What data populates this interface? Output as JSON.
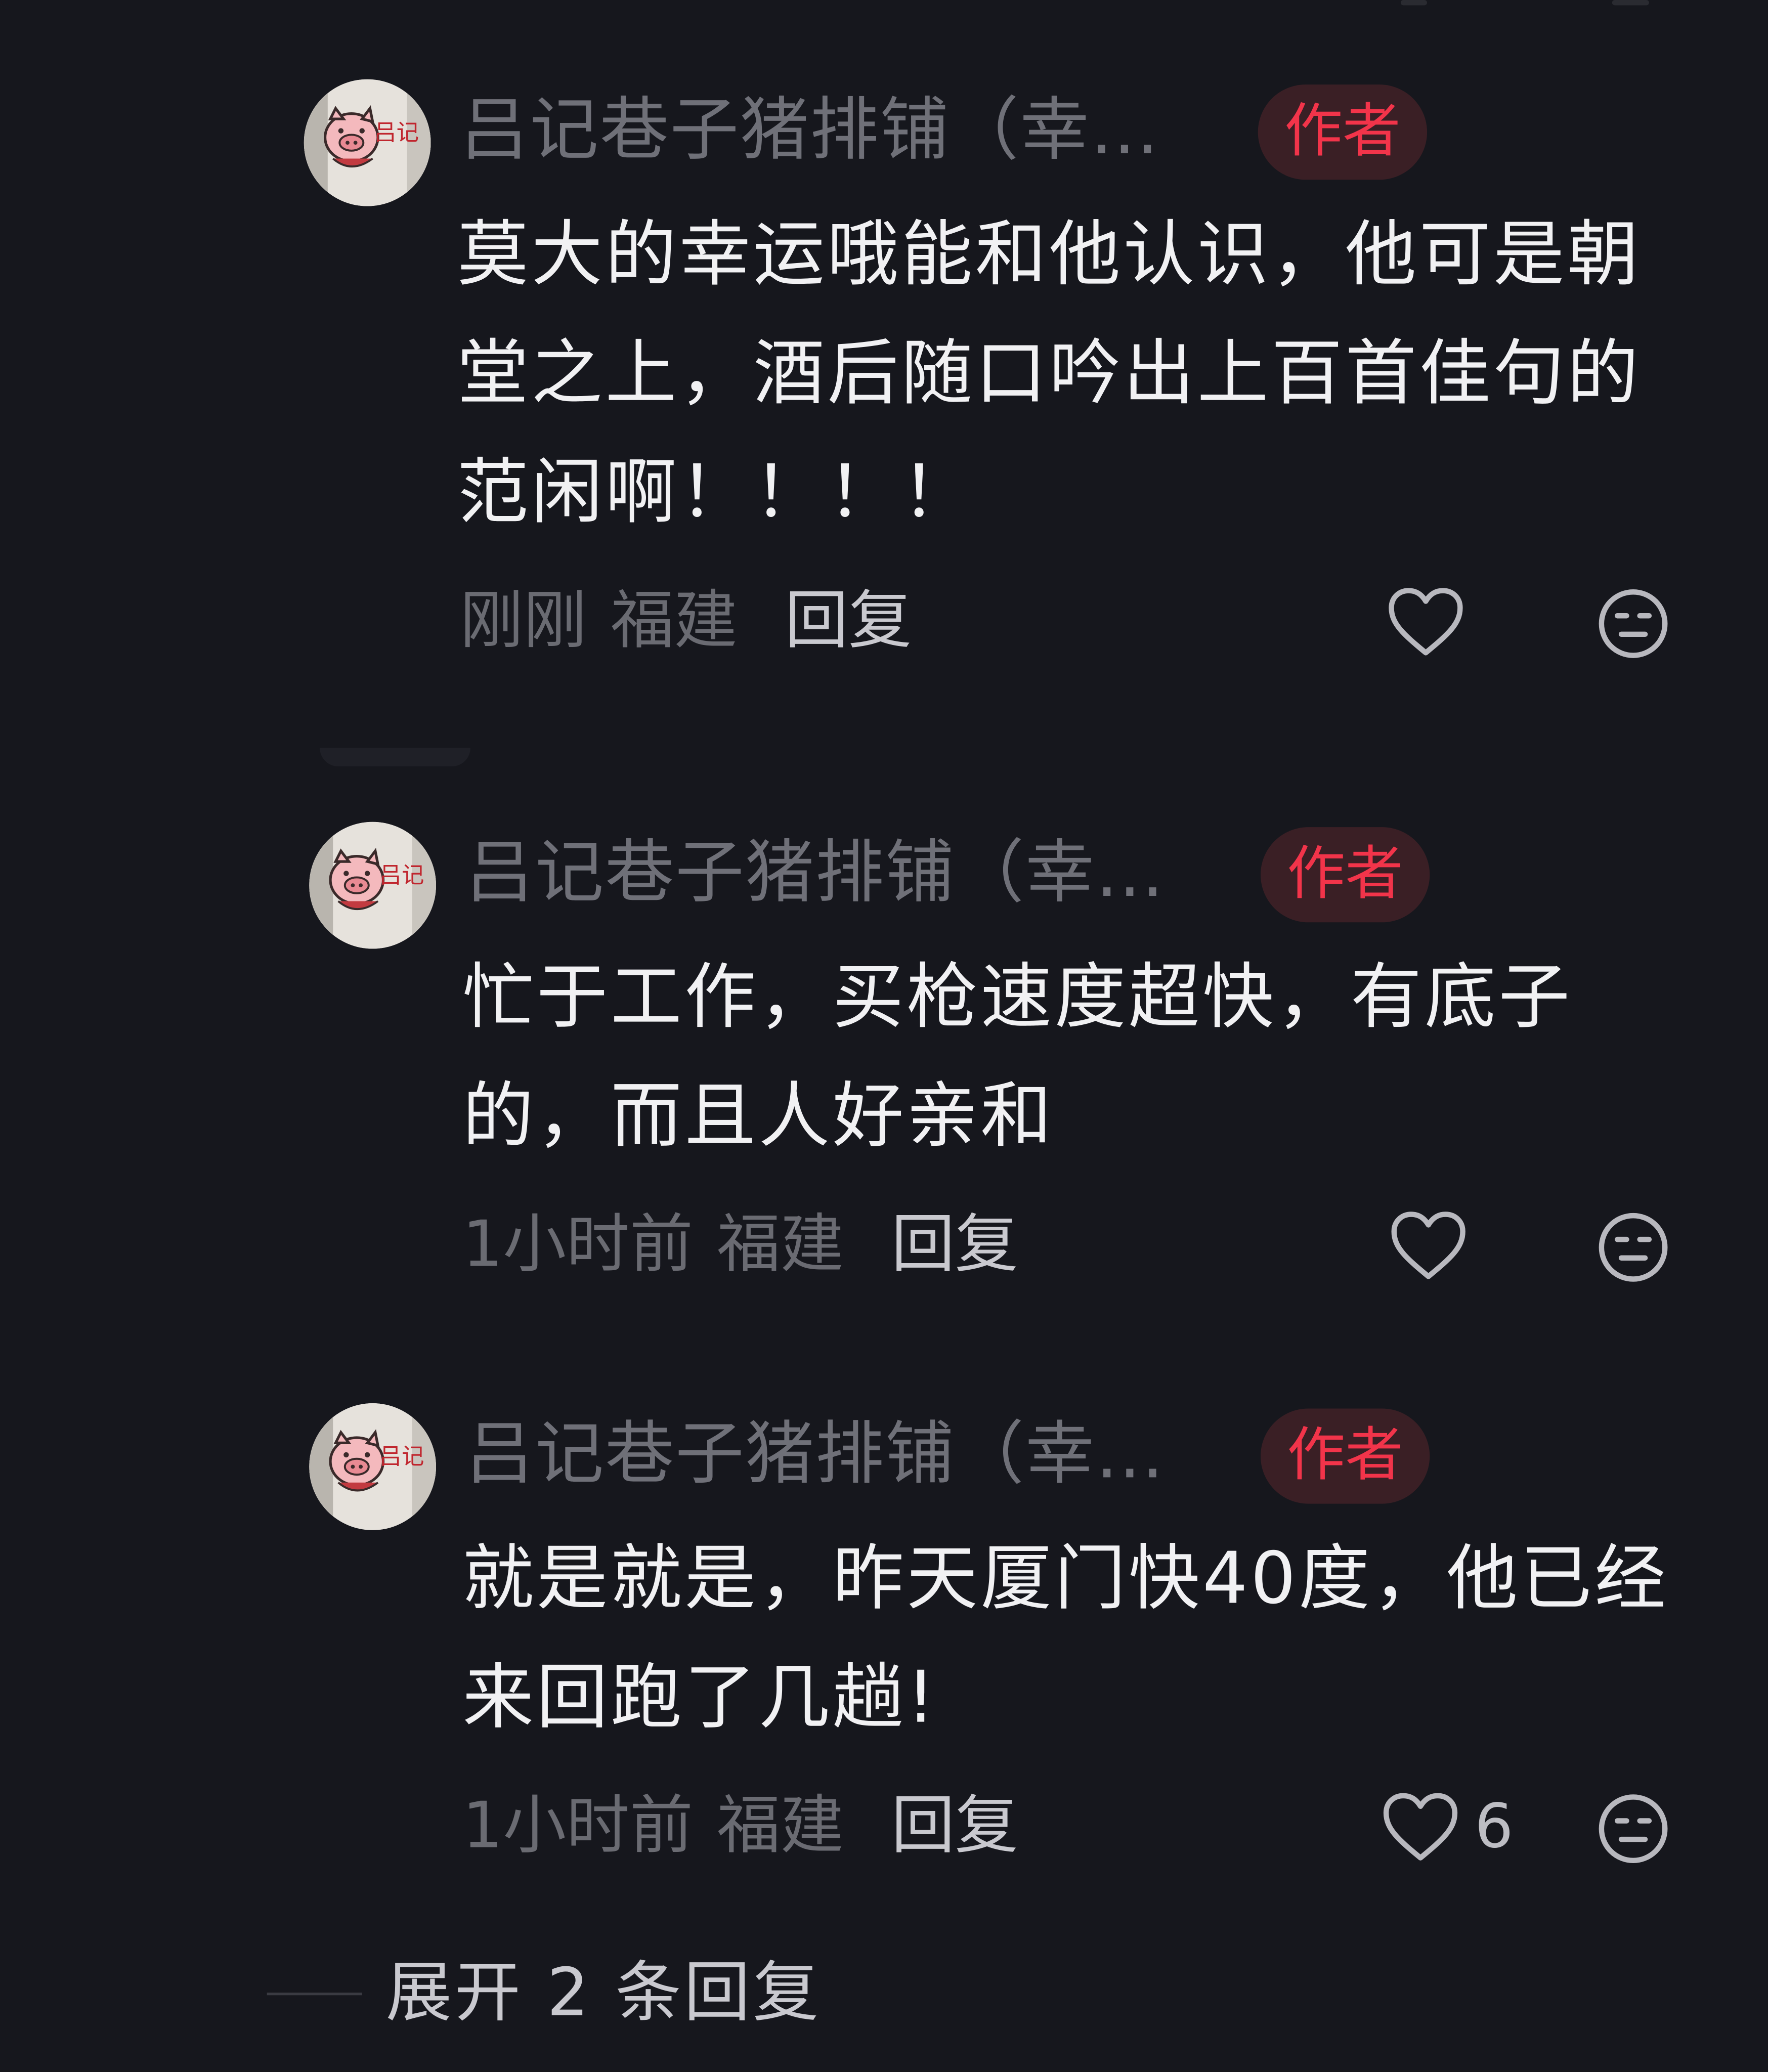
{
  "comments": [
    {
      "username": "吕记巷子猪排铺（幸…",
      "badge": "作者",
      "content": "莫大的幸运哦能和他认识，他可是朝堂之上，酒后随口吟出上百首佳句的范闲啊！！！！",
      "time": "刚刚",
      "location": "福建",
      "reply": "回复",
      "likes": ""
    },
    {
      "username": "吕记巷子猪排铺（幸…",
      "badge": "作者",
      "content": "忙于工作，买枪速度超快，有底子的，而且人好亲和",
      "time": "1小时前",
      "location": "福建",
      "reply": "回复",
      "likes": ""
    },
    {
      "username": "吕记巷子猪排铺（幸…",
      "badge": "作者",
      "content": "就是就是，昨天厦门快40度，他已经来回跑了几趟!",
      "time": "1小时前",
      "location": "福建",
      "reply": "回复",
      "likes": "6"
    }
  ],
  "avatar_text": "吕记",
  "expand": "展开 2 条回复",
  "icons": {
    "like": "heart-outline-icon",
    "dislike": "neutral-face-icon"
  },
  "colors": {
    "background": "#16171d",
    "badge_text": "#f2344a",
    "badge_bg": "#3a1f25"
  }
}
